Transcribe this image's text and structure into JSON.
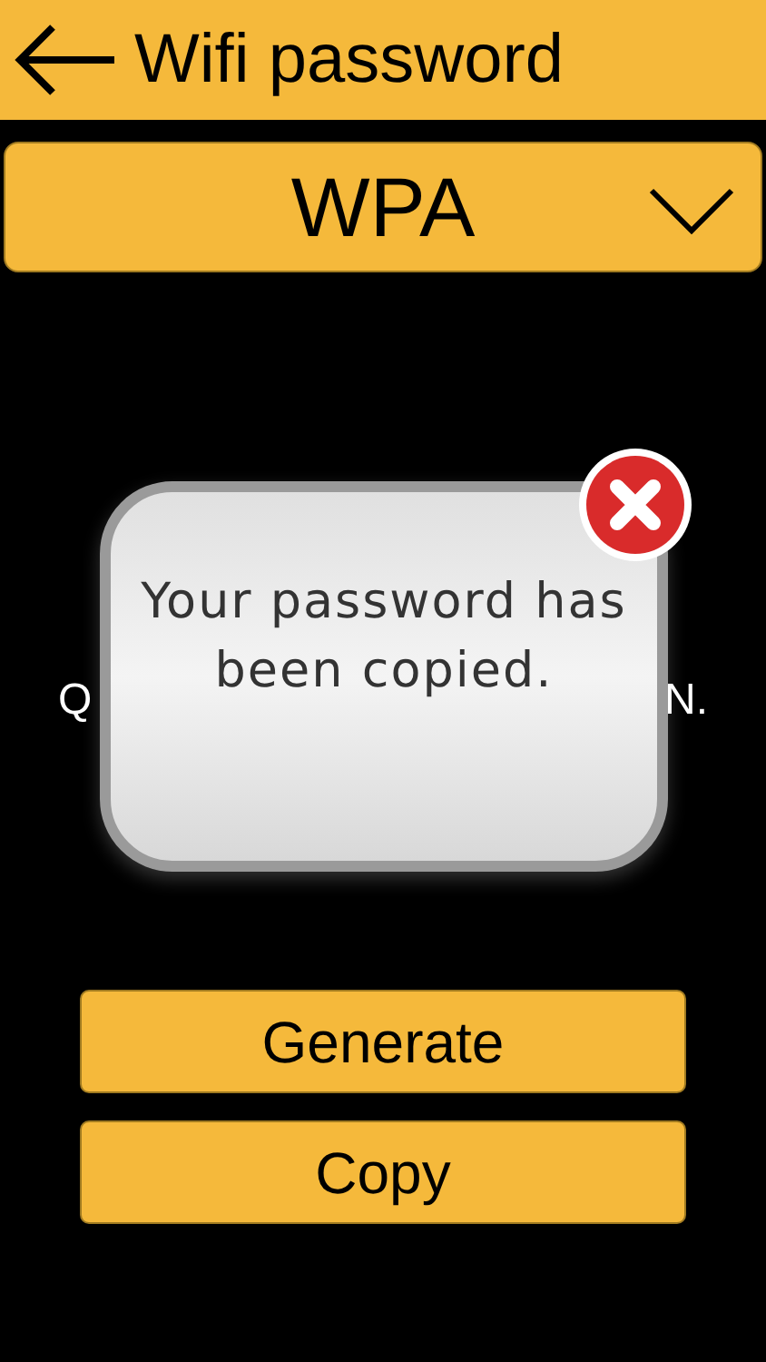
{
  "header": {
    "title": "Wifi password"
  },
  "security_dropdown": {
    "value": "WPA"
  },
  "password_visible_parts": [
    "Q",
    "N."
  ],
  "buttons": [
    {
      "label": "Generate"
    },
    {
      "label": "Copy"
    }
  ],
  "dialog": {
    "message": "Your password has been copied."
  }
}
